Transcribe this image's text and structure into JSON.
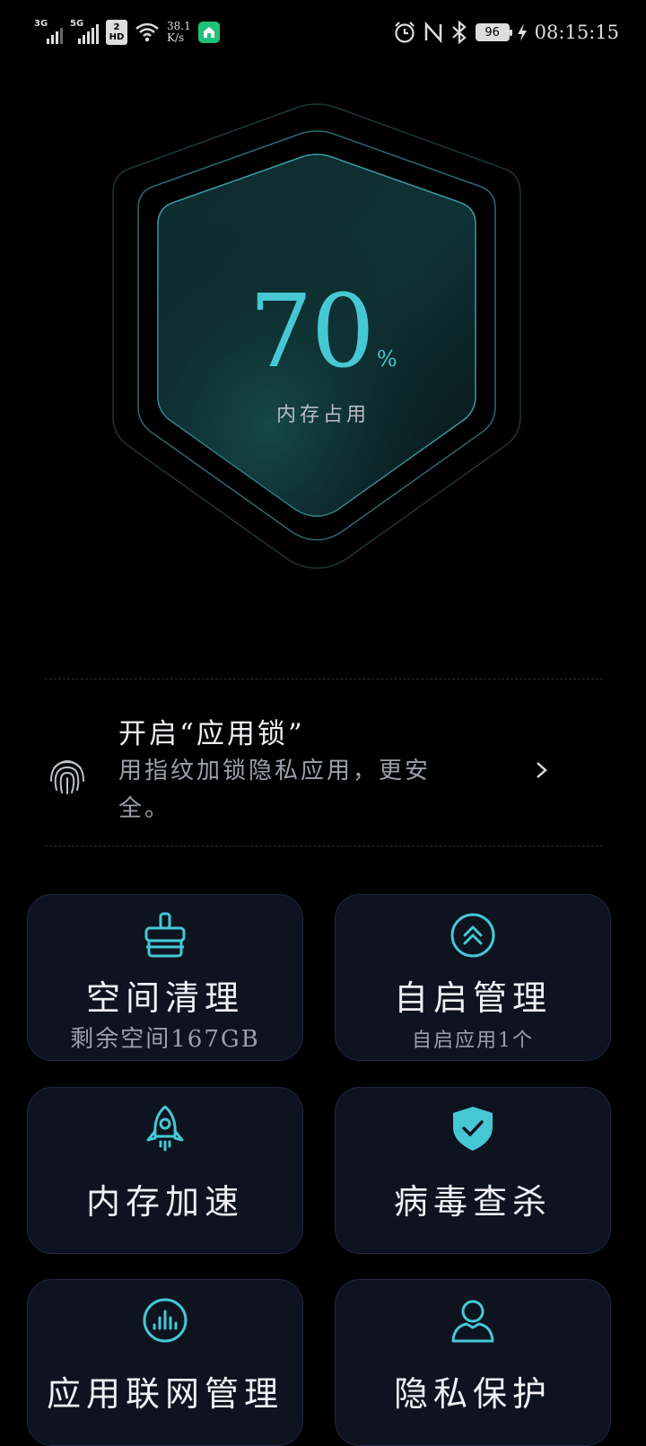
{
  "status_bar": {
    "signal1_label": "3G",
    "signal2_label": "5G",
    "hd_top": "2",
    "hd_bottom": "HD",
    "speed_value": "38.1",
    "speed_unit": "K/s",
    "battery_level": "96",
    "time": "08:15:15"
  },
  "gauge": {
    "value": "70",
    "unit": "%",
    "label": "内存占用",
    "accent_color": "#45c8d4"
  },
  "app_lock": {
    "title": "开启“应用锁”",
    "description": "用指纹加锁隐私应用，更安全。",
    "icon": "fingerprint-icon"
  },
  "features": [
    {
      "title": "空间清理",
      "subtitle": "剩余空间167GB",
      "icon": "broom-icon"
    },
    {
      "title": "自启管理",
      "subtitle": "自启应用1个",
      "icon": "double-chevron-up-icon"
    },
    {
      "title": "内存加速",
      "subtitle": "",
      "icon": "rocket-icon"
    },
    {
      "title": "病毒查杀",
      "subtitle": "",
      "icon": "shield-check-icon"
    },
    {
      "title": "应用联网管理",
      "subtitle": "",
      "icon": "network-bars-icon"
    },
    {
      "title": "隐私保护",
      "subtitle": "",
      "icon": "user-icon"
    }
  ]
}
